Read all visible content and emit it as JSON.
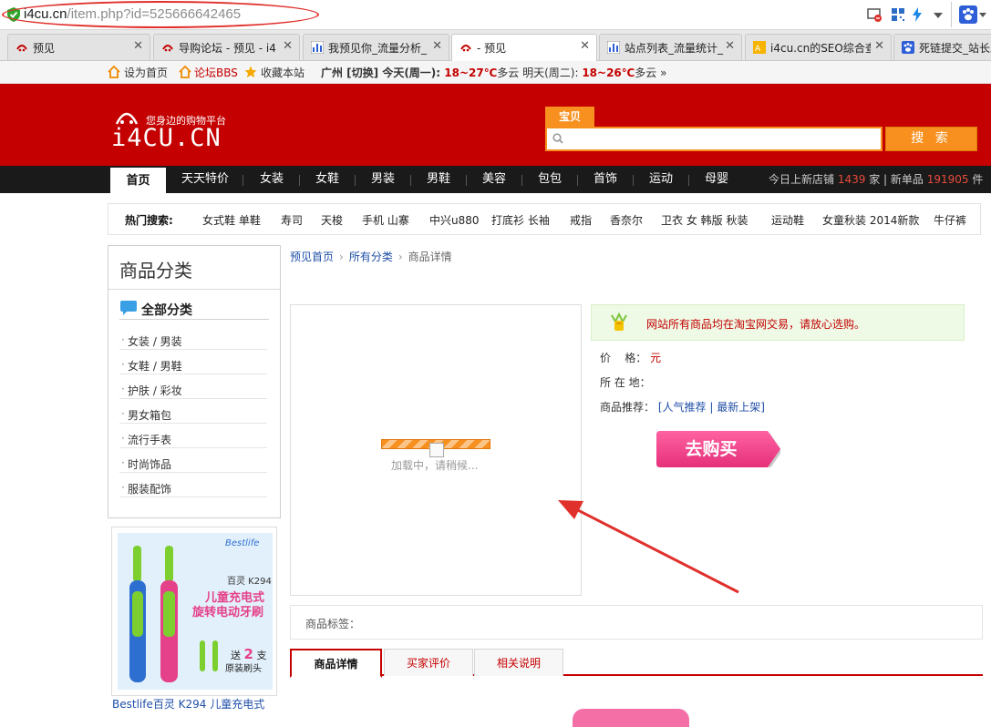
{
  "browser": {
    "url_domain": "i4cu.cn",
    "url_path": "/item.php?id=525666642465",
    "tabs": [
      {
        "title": "预见",
        "active": false
      },
      {
        "title": "导购论坛 - 预见 - i4",
        "active": false
      },
      {
        "title": "我预见你_流量分析_",
        "active": false
      },
      {
        "title": "- 预见",
        "active": true
      },
      {
        "title": "站点列表_流量统计_",
        "active": false
      },
      {
        "title": "i4cu.cn的SEO综合查",
        "active": false
      },
      {
        "title": "死链提交_站长工",
        "active": false
      }
    ],
    "bookmarks": {
      "homepage": "设为首页",
      "forum": "论坛BBS",
      "favorite": "收藏本站",
      "weather": "广州 [切换]  今天(周一): ",
      "today_range": "18~27℃",
      "today_desc": "多云  明天(周二): ",
      "tomorrow_range": "18~26℃",
      "tomorrow_desc": "多云 »"
    }
  },
  "header": {
    "slogan": "您身边的购物平台",
    "logo": "i4CU.CN",
    "search_tab": "宝贝",
    "search_value": "",
    "search_button": "搜 索"
  },
  "nav": {
    "items": [
      "首页",
      "天天特价",
      "女装",
      "女鞋",
      "男装",
      "男鞋",
      "美容",
      "包包",
      "首饰",
      "运动",
      "母婴"
    ],
    "stats_prefix": "今日上新店铺",
    "stores_count": "1439",
    "stats_mid": "家 | 新单品",
    "items_count": "191905",
    "stats_suffix": "件"
  },
  "hot_search": {
    "label": "热门搜索:",
    "keywords": [
      "女式鞋 单鞋",
      "寿司",
      "天梭",
      "手机 山寨",
      "中兴u880",
      "打底衫 长袖",
      "戒指",
      "香奈尔",
      "卫衣 女 韩版 秋装",
      "运动鞋",
      "女童秋装 2014新款",
      "牛仔裤"
    ]
  },
  "sidebar": {
    "title": "商品分类",
    "all_label": "全部分类",
    "items": [
      "女装 / 男装",
      "女鞋 / 男鞋",
      "护肤 / 彩妆",
      "男女箱包",
      "流行手表",
      "时尚饰品",
      "服装配饰"
    ],
    "ad": {
      "brand": "Bestlife",
      "model": "百灵 K294",
      "headline1": "儿童充电式",
      "headline2": "旋转电动牙刷",
      "promo1": "送",
      "promo_num": "2",
      "promo2": "支",
      "promo3": "原装刷头",
      "caption": "Bestlife百灵 K294 儿童充电式"
    }
  },
  "breadcrumb": {
    "home": "预见首页",
    "all": "所有分类",
    "current": "商品详情"
  },
  "product": {
    "loading_text": "加载中，请稍候...",
    "notice": "网站所有商品均在淘宝网交易，请放心选购。",
    "price_label": "价    格：",
    "price_value": "元",
    "location_label": "所 在 地：",
    "recommend_label": "商品推荐：",
    "recommend_open": "[",
    "recommend_hot": "人气推荐",
    "recommend_sep": "|",
    "recommend_new": "最新上架",
    "recommend_close": "]",
    "buy_button": "去购买",
    "tags_label": "商品标签："
  },
  "product_tabs": [
    "商品详情",
    "买家评价",
    "相关说明"
  ]
}
